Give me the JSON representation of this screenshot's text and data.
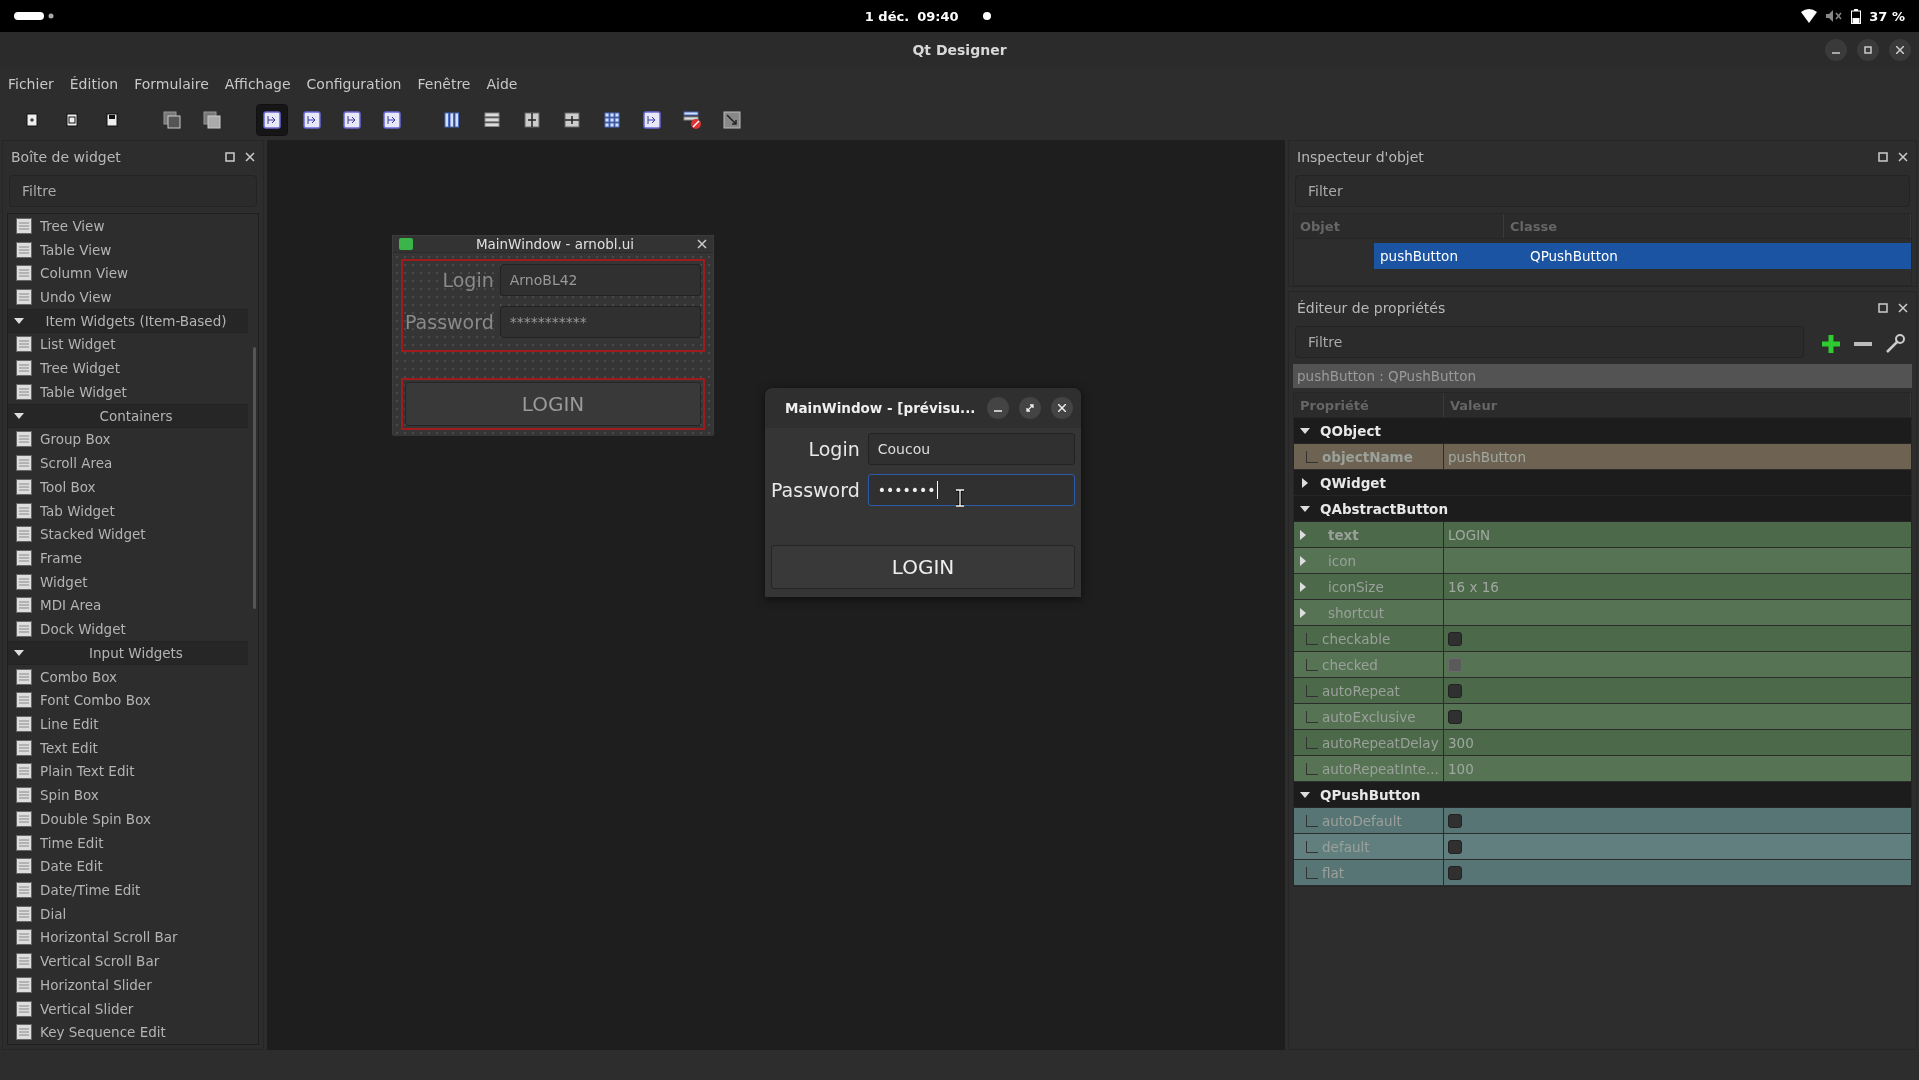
{
  "top_bar": {
    "date": "1 déc.",
    "time": "09:40",
    "battery": "37 %"
  },
  "window": {
    "title": "Qt Designer"
  },
  "menu": [
    {
      "label": "Fichier"
    },
    {
      "label": "Édition"
    },
    {
      "label": "Formulaire"
    },
    {
      "label": "Affichage"
    },
    {
      "label": "Configuration"
    },
    {
      "label": "Fenêtre"
    },
    {
      "label": "Aide"
    }
  ],
  "toolbar": [
    {
      "selected": false
    },
    {
      "selected": false
    },
    {
      "selected": false
    },
    {
      "selected": false
    },
    {
      "selected": false
    },
    {
      "selected": true
    },
    {
      "selected": false
    },
    {
      "selected": false
    },
    {
      "selected": false
    },
    {
      "selected": false
    },
    {
      "selected": false
    },
    {
      "selected": false
    },
    {
      "selected": false
    },
    {
      "selected": false
    },
    {
      "selected": false
    },
    {
      "selected": false
    },
    {
      "selected": false
    }
  ],
  "widget_box": {
    "title": "Boîte de widget",
    "filter_placeholder": "Filtre",
    "items": [
      {
        "kind": "item",
        "label": "Tree View"
      },
      {
        "kind": "item",
        "label": "Table View"
      },
      {
        "kind": "item",
        "label": "Column View"
      },
      {
        "kind": "item",
        "label": "Undo View"
      },
      {
        "kind": "category",
        "label": "Item Widgets (Item-Based)",
        "expanded": true
      },
      {
        "kind": "item",
        "label": "List Widget"
      },
      {
        "kind": "item",
        "label": "Tree Widget"
      },
      {
        "kind": "item",
        "label": "Table Widget"
      },
      {
        "kind": "category",
        "label": "Containers",
        "expanded": true
      },
      {
        "kind": "item",
        "label": "Group Box"
      },
      {
        "kind": "item",
        "label": "Scroll Area"
      },
      {
        "kind": "item",
        "label": "Tool Box"
      },
      {
        "kind": "item",
        "label": "Tab Widget"
      },
      {
        "kind": "item",
        "label": "Stacked Widget"
      },
      {
        "kind": "item",
        "label": "Frame"
      },
      {
        "kind": "item",
        "label": "Widget"
      },
      {
        "kind": "item",
        "label": "MDI Area"
      },
      {
        "kind": "item",
        "label": "Dock Widget"
      },
      {
        "kind": "category",
        "label": "Input Widgets",
        "expanded": true
      },
      {
        "kind": "item",
        "label": "Combo Box"
      },
      {
        "kind": "item",
        "label": "Font Combo Box"
      },
      {
        "kind": "item",
        "label": "Line Edit"
      },
      {
        "kind": "item",
        "label": "Text Edit"
      },
      {
        "kind": "item",
        "label": "Plain Text Edit"
      },
      {
        "kind": "item",
        "label": "Spin Box"
      },
      {
        "kind": "item",
        "label": "Double Spin Box"
      },
      {
        "kind": "item",
        "label": "Time Edit"
      },
      {
        "kind": "item",
        "label": "Date Edit"
      },
      {
        "kind": "item",
        "label": "Date/Time Edit"
      },
      {
        "kind": "item",
        "label": "Dial"
      },
      {
        "kind": "item",
        "label": "Horizontal Scroll Bar"
      },
      {
        "kind": "item",
        "label": "Vertical Scroll Bar"
      },
      {
        "kind": "item",
        "label": "Horizontal Slider"
      },
      {
        "kind": "item",
        "label": "Vertical Slider"
      },
      {
        "kind": "item",
        "label": "Key Sequence Edit"
      }
    ]
  },
  "form_window": {
    "title": "MainWindow - arnobl.ui",
    "login_label": "Login",
    "login_value": "ArnoBL42",
    "password_label": "Password",
    "password_value": "***********",
    "button": "LOGIN"
  },
  "preview_window": {
    "title": "MainWindow - [prévisu...",
    "login_label": "Login",
    "login_value": "Coucou",
    "password_label": "Password",
    "password_value": "•••••••",
    "password_focused": true,
    "button": "LOGIN"
  },
  "object_inspector": {
    "title": "Inspecteur d'objet",
    "filter_placeholder": "Filter",
    "columns": [
      "Objet",
      "Classe"
    ],
    "rows": [
      {
        "object": "pushButton",
        "class": "QPushButton",
        "selected": true
      }
    ]
  },
  "property_editor": {
    "title": "Éditeur de propriétés",
    "filter_placeholder": "Filtre",
    "class_label": "pushButton : QPushButton",
    "columns": [
      "Propriété",
      "Valeur"
    ],
    "groups": [
      {
        "name": "QObject",
        "expanded": true,
        "color": "#6e6353",
        "properties": [
          {
            "name": "objectName",
            "kind": "text",
            "value": "pushButton",
            "modified": true
          }
        ]
      },
      {
        "name": "QWidget",
        "expanded": false
      },
      {
        "name": "QAbstractButton",
        "expanded": true,
        "color": "#4c6a4a",
        "properties": [
          {
            "name": "text",
            "kind": "text",
            "value": "LOGIN",
            "modified": true,
            "expandable": true
          },
          {
            "name": "icon",
            "kind": "text",
            "expandable": true
          },
          {
            "name": "iconSize",
            "kind": "text",
            "value": "16 x 16",
            "expandable": true
          },
          {
            "name": "shortcut",
            "kind": "text",
            "expandable": true
          },
          {
            "name": "checkable",
            "kind": "checkbox",
            "checked": false
          },
          {
            "name": "checked",
            "kind": "checkbox",
            "checked": false,
            "disabled": true
          },
          {
            "name": "autoRepeat",
            "kind": "checkbox",
            "checked": false
          },
          {
            "name": "autoExclusive",
            "kind": "checkbox",
            "checked": false
          },
          {
            "name": "autoRepeatDelay",
            "kind": "text",
            "value": "300"
          },
          {
            "name": "autoRepeatInte...",
            "kind": "text",
            "value": "100"
          }
        ]
      },
      {
        "name": "QPushButton",
        "expanded": true,
        "color": "#587575",
        "properties": [
          {
            "name": "autoDefault",
            "kind": "checkbox",
            "checked": false
          },
          {
            "name": "default",
            "kind": "checkbox",
            "checked": false
          },
          {
            "name": "flat",
            "kind": "checkbox",
            "checked": false
          }
        ]
      }
    ]
  }
}
